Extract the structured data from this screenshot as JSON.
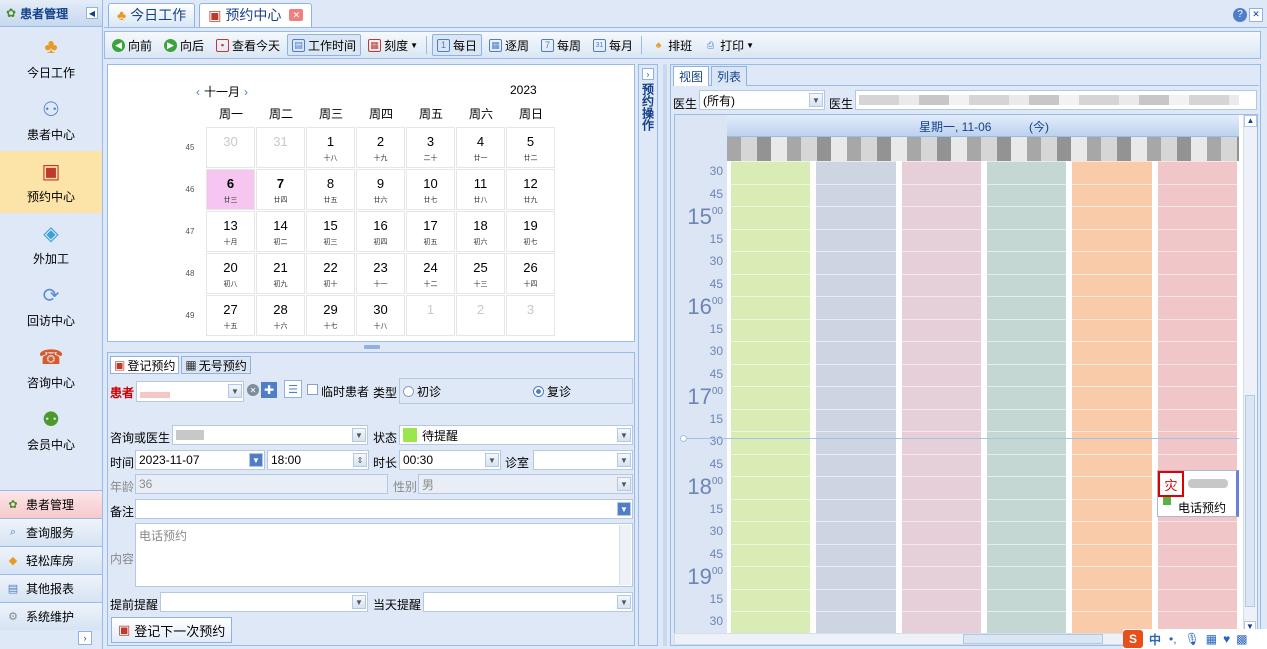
{
  "leftnav": {
    "title": "患者管理",
    "big_items": [
      {
        "label": "今日工作",
        "icon": "person-desk-icon"
      },
      {
        "label": "患者中心",
        "icon": "patients-icon"
      },
      {
        "label": "预约中心",
        "icon": "calendar-icon"
      },
      {
        "label": "外加工",
        "icon": "cubes-icon"
      },
      {
        "label": "回访中心",
        "icon": "refresh-icon"
      },
      {
        "label": "咨询中心",
        "icon": "consult-icon"
      },
      {
        "label": "会员中心",
        "icon": "members-icon"
      }
    ],
    "small_items": [
      {
        "label": "患者管理",
        "icon": "patients-small-icon"
      },
      {
        "label": "查询服务",
        "icon": "query-icon"
      },
      {
        "label": "轻松库房",
        "icon": "warehouse-icon"
      },
      {
        "label": "其他报表",
        "icon": "report-icon"
      },
      {
        "label": "系统维护",
        "icon": "settings-icon"
      }
    ]
  },
  "tabs": [
    {
      "label": "今日工作"
    },
    {
      "label": "预约中心"
    }
  ],
  "toolbar": {
    "prev": "向前",
    "next": "向后",
    "today": "查看今天",
    "work_time": "工作时间",
    "scale": "刻度",
    "daily": "每日",
    "per_week": "逐周",
    "weekly": "每周",
    "monthly": "每月",
    "schedule": "排班",
    "print": "打印"
  },
  "calendar": {
    "month": "十一月",
    "year": "2023",
    "weekdays": [
      "周一",
      "周二",
      "周三",
      "周四",
      "周五",
      "周六",
      "周日"
    ],
    "weeks": [
      "45",
      "46",
      "47",
      "48",
      "49"
    ],
    "days": [
      [
        {
          "d": "30",
          "l": "",
          "o": true
        },
        {
          "d": "31",
          "l": "",
          "o": true
        },
        {
          "d": "1",
          "l": "十八"
        },
        {
          "d": "2",
          "l": "十九"
        },
        {
          "d": "3",
          "l": "二十"
        },
        {
          "d": "4",
          "l": "廿一"
        },
        {
          "d": "5",
          "l": "廿二"
        }
      ],
      [
        {
          "d": "6",
          "l": "廿三",
          "t": true
        },
        {
          "d": "7",
          "l": "廿四",
          "s": true
        },
        {
          "d": "8",
          "l": "廿五"
        },
        {
          "d": "9",
          "l": "廿六"
        },
        {
          "d": "10",
          "l": "廿七"
        },
        {
          "d": "11",
          "l": "廿八"
        },
        {
          "d": "12",
          "l": "廿九"
        }
      ],
      [
        {
          "d": "13",
          "l": "十月"
        },
        {
          "d": "14",
          "l": "初二"
        },
        {
          "d": "15",
          "l": "初三"
        },
        {
          "d": "16",
          "l": "初四"
        },
        {
          "d": "17",
          "l": "初五"
        },
        {
          "d": "18",
          "l": "初六"
        },
        {
          "d": "19",
          "l": "初七"
        }
      ],
      [
        {
          "d": "20",
          "l": "初八"
        },
        {
          "d": "21",
          "l": "初九"
        },
        {
          "d": "22",
          "l": "初十"
        },
        {
          "d": "23",
          "l": "十一"
        },
        {
          "d": "24",
          "l": "十二"
        },
        {
          "d": "25",
          "l": "十三"
        },
        {
          "d": "26",
          "l": "十四"
        }
      ],
      [
        {
          "d": "27",
          "l": "十五"
        },
        {
          "d": "28",
          "l": "十六"
        },
        {
          "d": "29",
          "l": "十七"
        },
        {
          "d": "30",
          "l": "十八"
        },
        {
          "d": "1",
          "l": "",
          "o": true
        },
        {
          "d": "2",
          "l": "",
          "o": true
        },
        {
          "d": "3",
          "l": "",
          "o": true
        }
      ]
    ]
  },
  "sidepanel": {
    "label": "预约操作"
  },
  "form": {
    "tab_register": "登记预约",
    "tab_noid": "无号预约",
    "patient_label": "患者",
    "temp_patient": "临时患者",
    "type_label": "类型",
    "first_visit": "初诊",
    "return_visit": "复诊",
    "consult_label": "咨询或医生",
    "status_label": "状态",
    "status_value": "待提醒",
    "status_color": "#99e64d",
    "time_label": "时间",
    "date_value": "2023-11-07",
    "time_value": "18:00",
    "duration_label": "时长",
    "duration_value": "00:30",
    "room_label": "诊室",
    "age_label": "年龄",
    "age_value": "36",
    "gender_label": "性别",
    "gender_value": "男",
    "note_label": "备注",
    "content_label": "内容",
    "content_value": "电话预约",
    "remind_before_label": "提前提醒",
    "remind_day_label": "当天提醒",
    "next_button": "登记下一次预约"
  },
  "scheduler": {
    "tab_view": "视图",
    "tab_list": "列表",
    "doctor_label": "医生",
    "doctor_value": "(所有)",
    "day_header": "星期一, 11-06",
    "today_tag": "(今)",
    "slots": [
      {
        "label": "30",
        "hour": false
      },
      {
        "label": "45",
        "hour": false
      },
      {
        "label": "15",
        "hour": true,
        "sup": "00"
      },
      {
        "label": "15",
        "hour": false
      },
      {
        "label": "30",
        "hour": false
      },
      {
        "label": "45",
        "hour": false
      },
      {
        "label": "16",
        "hour": true,
        "sup": "00"
      },
      {
        "label": "15",
        "hour": false
      },
      {
        "label": "30",
        "hour": false
      },
      {
        "label": "45",
        "hour": false
      },
      {
        "label": "17",
        "hour": true,
        "sup": "00"
      },
      {
        "label": "15",
        "hour": false
      },
      {
        "label": "30",
        "hour": false
      },
      {
        "label": "45",
        "hour": false
      },
      {
        "label": "18",
        "hour": true,
        "sup": "00"
      },
      {
        "label": "15",
        "hour": false
      },
      {
        "label": "30",
        "hour": false
      },
      {
        "label": "45",
        "hour": false
      },
      {
        "label": "19",
        "hour": true,
        "sup": "00"
      },
      {
        "label": "15",
        "hour": false
      },
      {
        "label": "30",
        "hour": false
      }
    ],
    "columns": [
      "#d9ecb5",
      "#cdd5e3",
      "#e6cfd8",
      "#c4d7d2",
      "#f9cba8",
      "#f1c6c8"
    ],
    "appt_badge": "灾",
    "appt_text": "电话预约"
  },
  "ime": {
    "lang": "中"
  }
}
